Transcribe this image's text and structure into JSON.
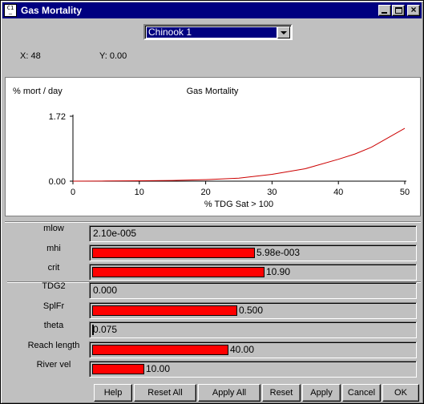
{
  "window": {
    "title": "Gas Mortality",
    "icon_text": "C₁\n–"
  },
  "selector": {
    "value": "Chinook 1"
  },
  "coords": {
    "x": "X: 48",
    "y": "Y: 0.00"
  },
  "chart_data": {
    "type": "line",
    "title": "Gas Mortality",
    "ylabel": "% mort / day",
    "xlabel": "% TDG Sat > 100",
    "xlim": [
      0,
      50
    ],
    "ylim": [
      0,
      1.72
    ],
    "x_ticks": [
      "0",
      "10",
      "20",
      "30",
      "40",
      "50"
    ],
    "y_ticks": [
      "0.00",
      "1.72"
    ],
    "grid": false,
    "series": [
      {
        "color": "#cc0000",
        "x": [
          0,
          5,
          10,
          15,
          20,
          25,
          30,
          35,
          40,
          42.5,
          45,
          47.5,
          50
        ],
        "y": [
          0.0,
          0.005,
          0.01,
          0.02,
          0.04,
          0.08,
          0.18,
          0.33,
          0.58,
          0.72,
          0.9,
          1.15,
          1.4
        ]
      }
    ]
  },
  "params": [
    {
      "label": "mlow",
      "value": "2.10e-005",
      "fill": 0
    },
    {
      "label": "mhi",
      "value": "5.98e-003",
      "fill": 0.506
    },
    {
      "label": "crit",
      "value": "10.90",
      "fill": 0.535
    },
    {
      "label": "TDG2",
      "value": "0.000",
      "fill": 0
    },
    {
      "label": "SplFr",
      "value": "0.500",
      "fill": 0.452
    },
    {
      "label": "theta",
      "value": "0.075",
      "fill": 0,
      "marker": true
    },
    {
      "label": "Reach length",
      "value": "40.00",
      "fill": 0.425
    },
    {
      "label": "River vel",
      "value": "10.00",
      "fill": 0.161
    }
  ],
  "buttons": {
    "help": "Help",
    "reset_all": "Reset All",
    "apply_all": "Apply All",
    "reset": "Reset",
    "apply": "Apply",
    "cancel": "Cancel",
    "ok": "OK"
  },
  "colors": {
    "titlebar": "#000080",
    "bar_fill": "#ff0000",
    "curve": "#cc0000"
  }
}
